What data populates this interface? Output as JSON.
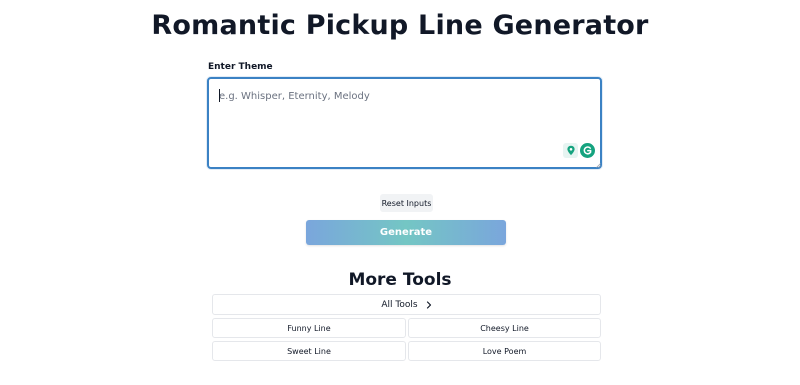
{
  "header": {
    "title": "Romantic Pickup Line Generator"
  },
  "form": {
    "theme_label": "Enter Theme",
    "theme_value": "",
    "theme_placeholder": "e.g. Whisper, Eternity, Melody",
    "reset_label": "Reset Inputs",
    "generate_label": "Generate"
  },
  "more_tools": {
    "title": "More Tools",
    "all_tools_label": "All Tools",
    "items": [
      {
        "label": "Funny Line"
      },
      {
        "label": "Cheesy Line"
      },
      {
        "label": "Sweet Line"
      },
      {
        "label": "Love Poem"
      }
    ]
  },
  "icons": {
    "extension_pin": "location-pin-icon",
    "grammarly": "grammarly-icon",
    "all_tools_arrow": "chevron-right-icon"
  },
  "colors": {
    "focus_border": "#3b82c4",
    "generate_gradient_start": "#7aa6dc",
    "generate_gradient_mid": "#74c6c4",
    "grammarly_green": "#15a37f"
  }
}
